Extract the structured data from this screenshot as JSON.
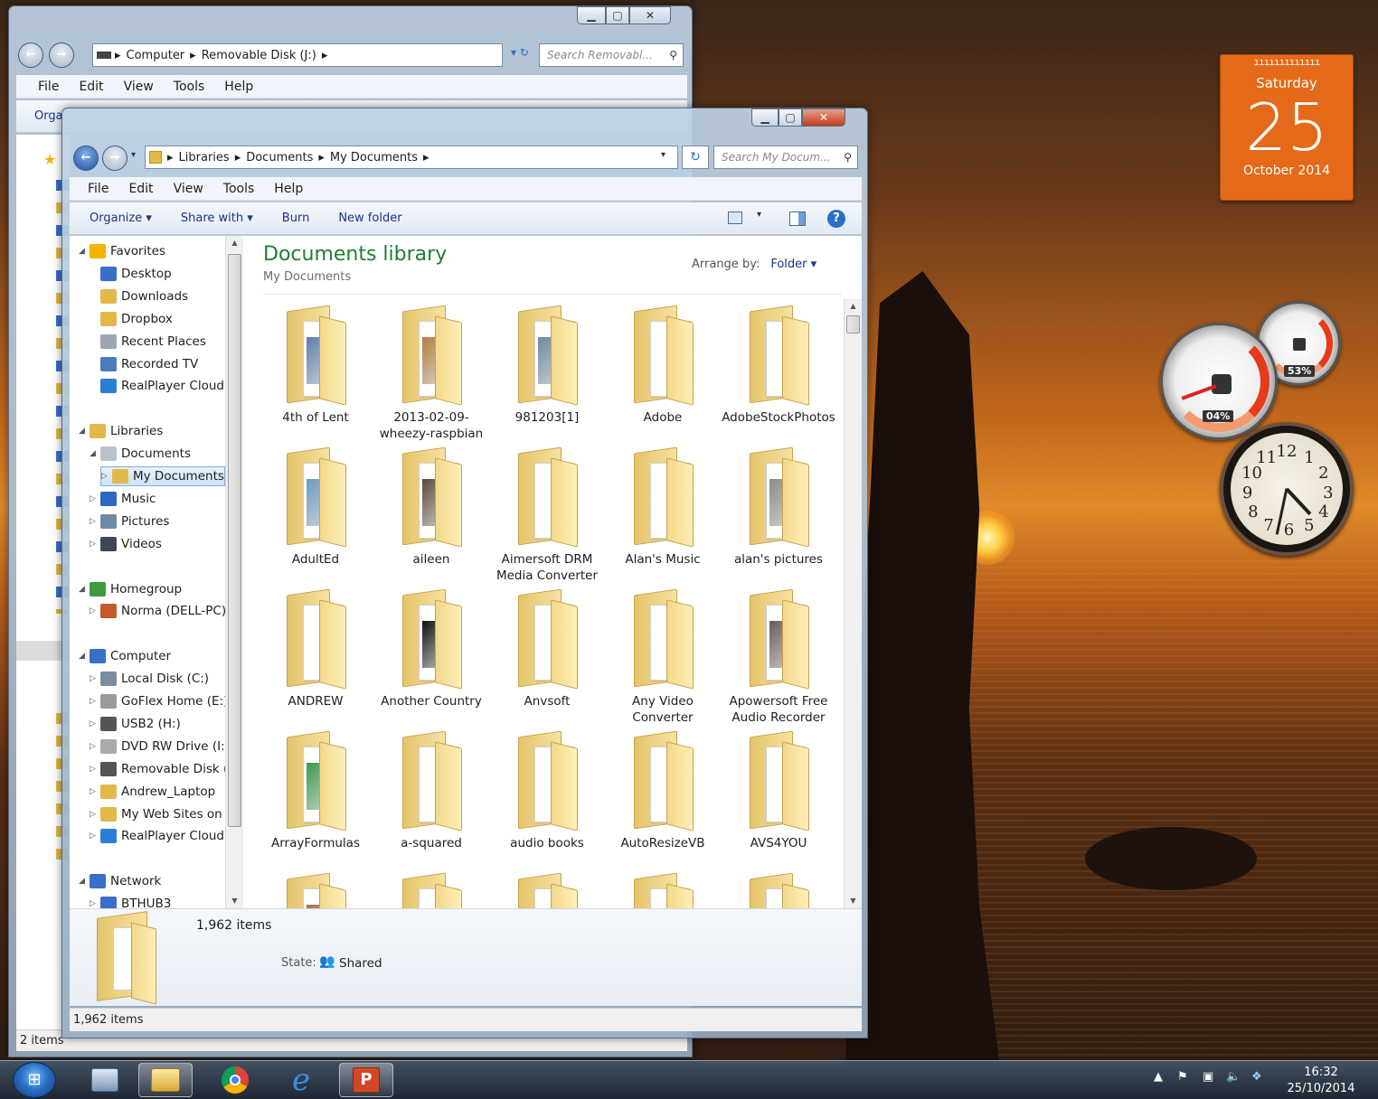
{
  "calendar": {
    "rings": "ııııııııııııı",
    "day_name": "Saturday",
    "day_number": "25",
    "month_year": "October 2014"
  },
  "meters": {
    "cpu": "04%",
    "memory": "53%"
  },
  "clock": {
    "numbers": [
      "12",
      "1",
      "2",
      "3",
      "4",
      "5",
      "6",
      "7",
      "8",
      "9",
      "10",
      "11"
    ],
    "hour_hand": "4:32",
    "minute_hand": "32"
  },
  "back_window": {
    "address": [
      "Computer",
      "Removable Disk (J:)"
    ],
    "search_placeholder": "Search Removabl...",
    "menu": [
      "File",
      "Edit",
      "View",
      "Tools",
      "Help"
    ],
    "toolbar_partial": "Orga",
    "status": "2 items"
  },
  "front_window": {
    "address": [
      "Libraries",
      "Documents",
      "My Documents"
    ],
    "search_placeholder": "Search My Docum...",
    "menu": [
      "File",
      "Edit",
      "View",
      "Tools",
      "Help"
    ],
    "toolbar": {
      "organize": "Organize ▾",
      "share_with": "Share with ▾",
      "burn": "Burn",
      "new_folder": "New folder"
    },
    "nav": [
      {
        "label": "Favorites",
        "level": 0,
        "arrow": "◢",
        "icon": "favorites-star-icon",
        "color": "#f3b400"
      },
      {
        "label": "Desktop",
        "level": 1,
        "icon": "desktop-icon",
        "color": "#3a6fc9"
      },
      {
        "label": "Downloads",
        "level": 1,
        "icon": "downloads-folder-icon",
        "color": "#e2b84a"
      },
      {
        "label": "Dropbox",
        "level": 1,
        "icon": "dropbox-folder-icon",
        "color": "#e2b84a"
      },
      {
        "label": "Recent Places",
        "level": 1,
        "icon": "recent-places-icon",
        "color": "#9aa6b4"
      },
      {
        "label": "Recorded TV",
        "level": 1,
        "icon": "recorded-tv-icon",
        "color": "#4b7bb8"
      },
      {
        "label": "RealPlayer Cloud",
        "level": 1,
        "icon": "realplayer-cloud-icon",
        "color": "#2a7fd4"
      },
      {
        "label": "",
        "level": 0,
        "icon": "",
        "color": ""
      },
      {
        "label": "Libraries",
        "level": 0,
        "arrow": "◢",
        "icon": "libraries-icon",
        "color": "#e2b84a"
      },
      {
        "label": "Documents",
        "level": 1,
        "arrow": "◢",
        "icon": "documents-icon",
        "color": "#b9c3ce"
      },
      {
        "label": "My Documents",
        "level": 2,
        "arrow": "▷",
        "icon": "my-documents-folder-icon",
        "color": "#e2b84a",
        "selected": true
      },
      {
        "label": "Music",
        "level": 1,
        "arrow": "▷",
        "icon": "music-icon",
        "color": "#2c68c4"
      },
      {
        "label": "Pictures",
        "level": 1,
        "arrow": "▷",
        "icon": "pictures-icon",
        "color": "#6f8aa6"
      },
      {
        "label": "Videos",
        "level": 1,
        "arrow": "▷",
        "icon": "videos-icon",
        "color": "#3c4858"
      },
      {
        "label": "",
        "level": 0,
        "icon": "",
        "color": ""
      },
      {
        "label": "Homegroup",
        "level": 0,
        "arrow": "◢",
        "icon": "homegroup-icon",
        "color": "#3f9a3f"
      },
      {
        "label": "Norma (DELL-PC)",
        "level": 1,
        "arrow": "▷",
        "icon": "user-icon",
        "color": "#c25a2a"
      },
      {
        "label": "",
        "level": 0,
        "icon": "",
        "color": ""
      },
      {
        "label": "Computer",
        "level": 0,
        "arrow": "◢",
        "icon": "computer-icon",
        "color": "#3a6fc9"
      },
      {
        "label": "Local Disk (C:)",
        "level": 1,
        "arrow": "▷",
        "icon": "local-disk-icon",
        "color": "#7a8ca0"
      },
      {
        "label": "GoFlex Home (E:)",
        "level": 1,
        "arrow": "▷",
        "icon": "network-drive-icon",
        "color": "#9a9a9a"
      },
      {
        "label": "USB2 (H:)",
        "level": 1,
        "arrow": "▷",
        "icon": "usb-drive-icon",
        "color": "#555"
      },
      {
        "label": "DVD RW Drive (I:)",
        "level": 1,
        "arrow": "▷",
        "icon": "dvd-drive-icon",
        "color": "#aaa"
      },
      {
        "label": "Removable Disk (J:)",
        "level": 1,
        "arrow": "▷",
        "icon": "removable-disk-icon",
        "color": "#555"
      },
      {
        "label": "Andrew_Laptop",
        "level": 1,
        "arrow": "▷",
        "icon": "folder-icon",
        "color": "#e2b84a"
      },
      {
        "label": "My Web Sites on MSN",
        "level": 1,
        "arrow": "▷",
        "icon": "folder-icon",
        "color": "#e2b84a"
      },
      {
        "label": "RealPlayer Cloud",
        "level": 1,
        "arrow": "▷",
        "icon": "realplayer-cloud-icon",
        "color": "#2a7fd4"
      },
      {
        "label": "",
        "level": 0,
        "icon": "",
        "color": ""
      },
      {
        "label": "Network",
        "level": 0,
        "arrow": "◢",
        "icon": "network-icon",
        "color": "#3a6fc9"
      },
      {
        "label": "BTHUB3",
        "level": 1,
        "arrow": "▷",
        "icon": "computer-icon",
        "color": "#3a6fc9"
      }
    ],
    "library_title": "Documents library",
    "library_subtitle": "My Documents",
    "arrange_label": "Arrange by:",
    "arrange_value": "Folder ▾",
    "folders": [
      {
        "name": "4th of Lent",
        "img": "#5b7fb0"
      },
      {
        "name": "2013-02-09-wheezy-raspbian",
        "img": "#b08040"
      },
      {
        "name": "981203[1]",
        "img": "#6a8aa0"
      },
      {
        "name": "Adobe",
        "img": ""
      },
      {
        "name": "AdobeStockPhotos",
        "img": ""
      },
      {
        "name": "AdultEd",
        "img": "#6a9ac0"
      },
      {
        "name": "aileen",
        "img": "#5a4a3a"
      },
      {
        "name": "Aimersoft DRM Media Converter",
        "img": ""
      },
      {
        "name": "Alan's Music",
        "img": ""
      },
      {
        "name": "alan's pictures",
        "img": "#8a8a8a"
      },
      {
        "name": "ANDREW",
        "img": ""
      },
      {
        "name": "Another Country",
        "img": "#111"
      },
      {
        "name": "Anvsoft",
        "img": ""
      },
      {
        "name": "Any Video Converter",
        "img": ""
      },
      {
        "name": "Apowersoft Free Audio Recorder",
        "img": "#6a5a5a"
      },
      {
        "name": "ArrayFormulas",
        "img": "#3a9a4a"
      },
      {
        "name": "a-squared",
        "img": ""
      },
      {
        "name": "audio books",
        "img": ""
      },
      {
        "name": "AutoResizeVB",
        "img": ""
      },
      {
        "name": "AVS4YOU",
        "img": ""
      },
      {
        "name": "",
        "img": "#a07050"
      },
      {
        "name": "",
        "img": ""
      },
      {
        "name": "",
        "img": ""
      },
      {
        "name": "",
        "img": ""
      },
      {
        "name": "",
        "img": ""
      }
    ],
    "details": {
      "count": "1,962 items",
      "state_label": "State:",
      "state_value": "Shared"
    },
    "status": "1,962 items"
  },
  "taskbar": {
    "time": "16:32",
    "date": "25/10/2014",
    "items": [
      "windows-explorer",
      "explorer-libraries",
      "chrome",
      "internet-explorer",
      "powerpoint"
    ]
  }
}
